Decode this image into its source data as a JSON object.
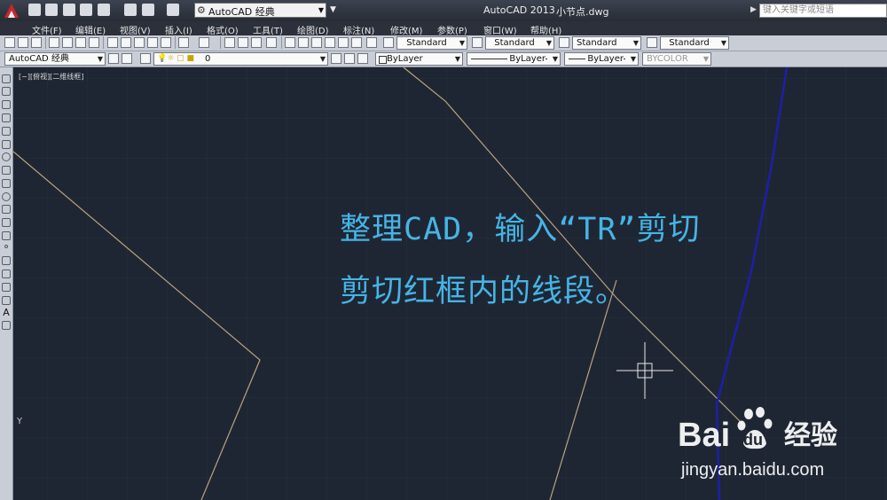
{
  "app": {
    "title": "AutoCAD 2013",
    "filename": "小节点.dwg",
    "workspace": "AutoCAD 经典",
    "search_placeholder": "键入关键字或短语"
  },
  "menu": [
    "文件(F)",
    "编辑(E)",
    "视图(V)",
    "插入(I)",
    "格式(O)",
    "工具(T)",
    "绘图(D)",
    "标注(N)",
    "修改(M)",
    "参数(P)",
    "窗口(W)",
    "帮助(H)"
  ],
  "styles": {
    "text_style": "Standard",
    "dim_style": "Standard",
    "table_style": "Standard",
    "multileader_style": "Standard"
  },
  "layers": {
    "workspace": "AutoCAD 经典",
    "current_layer": "0",
    "color": "ByLayer",
    "linetype": "ByLayer",
    "lineweight": "ByLayer",
    "plotstyle": "BYCOLOR"
  },
  "viewport": {
    "label": "[−][俯视][二维线框]",
    "y_axis": "Y"
  },
  "overlay": {
    "line1": "整理CAD，输入“TR”剪切",
    "line2": "剪切红框内的线段。"
  },
  "watermark": {
    "url": "jingyan.baidu.com"
  },
  "colors": {
    "canvas_bg": "#1f2633",
    "grid": "#2b3342",
    "line_tan": "#b9a382",
    "line_blue": "#1d1fa8",
    "overlay_text": "#45b4e6"
  }
}
